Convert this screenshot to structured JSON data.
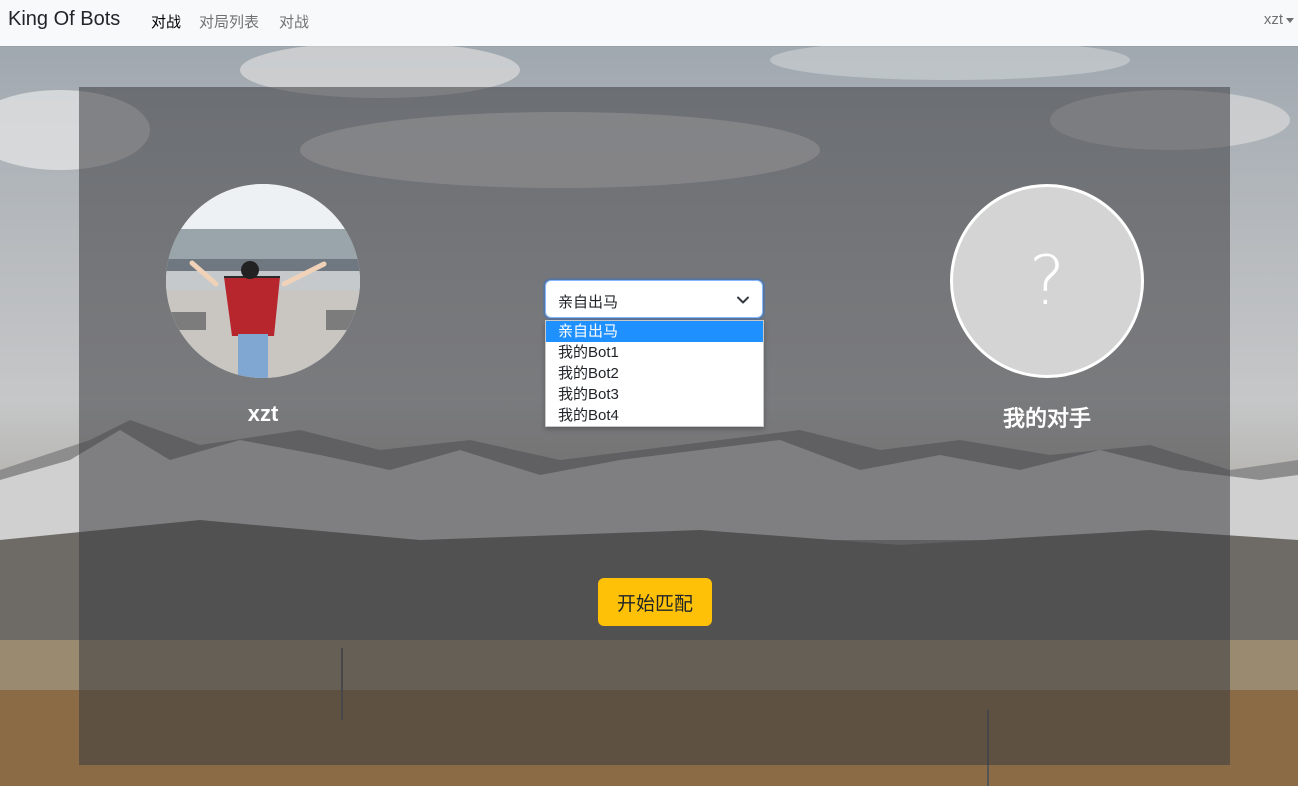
{
  "navbar": {
    "brand": "King Of Bots",
    "links": [
      {
        "label": "对战",
        "active": true
      },
      {
        "label": "对局列表",
        "active": false
      },
      {
        "label": "对战",
        "active": false
      }
    ],
    "user": "xzt"
  },
  "match": {
    "me": {
      "name": "xzt",
      "avatar": "user-photo"
    },
    "opponent": {
      "name": "我的对手",
      "avatar": "question-icon"
    },
    "select": {
      "value": "亲自出马",
      "options": [
        "亲自出马",
        "我的Bot1",
        "我的Bot2",
        "我的Bot3",
        "我的Bot4"
      ],
      "highlighted_index": 0
    },
    "start_button": "开始匹配"
  },
  "colors": {
    "accent": "#ffc107",
    "navbar_bg": "#f8f9fa",
    "dropdown_highlight": "#1e90ff"
  }
}
